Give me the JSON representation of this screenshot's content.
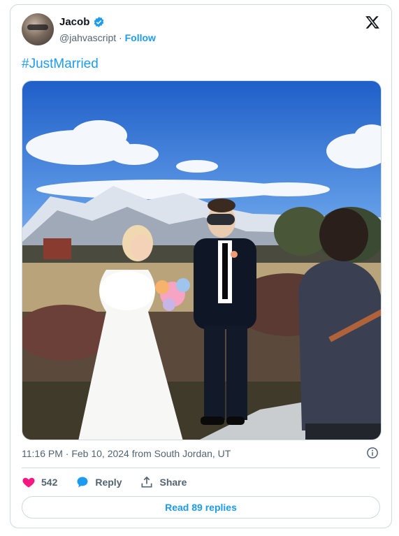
{
  "author": {
    "name": "Jacob",
    "handle": "@jahvascript",
    "separator": "·",
    "follow_label": "Follow"
  },
  "tweet": {
    "text": "#JustMarried"
  },
  "meta": {
    "timestamp": "11:16 PM · Feb 10, 2024 from South Jordan, UT"
  },
  "actions": {
    "like_count": "542",
    "reply_label": "Reply",
    "share_label": "Share"
  },
  "read_replies": "Read 89 replies",
  "icons": [
    "avatar",
    "verified-badge-icon",
    "x-logo-icon",
    "info-icon",
    "heart-icon",
    "reply-bubble-icon",
    "share-icon"
  ],
  "colors": {
    "accent": "#1d9bf0",
    "like": "#f91880",
    "text_muted": "#536471"
  }
}
